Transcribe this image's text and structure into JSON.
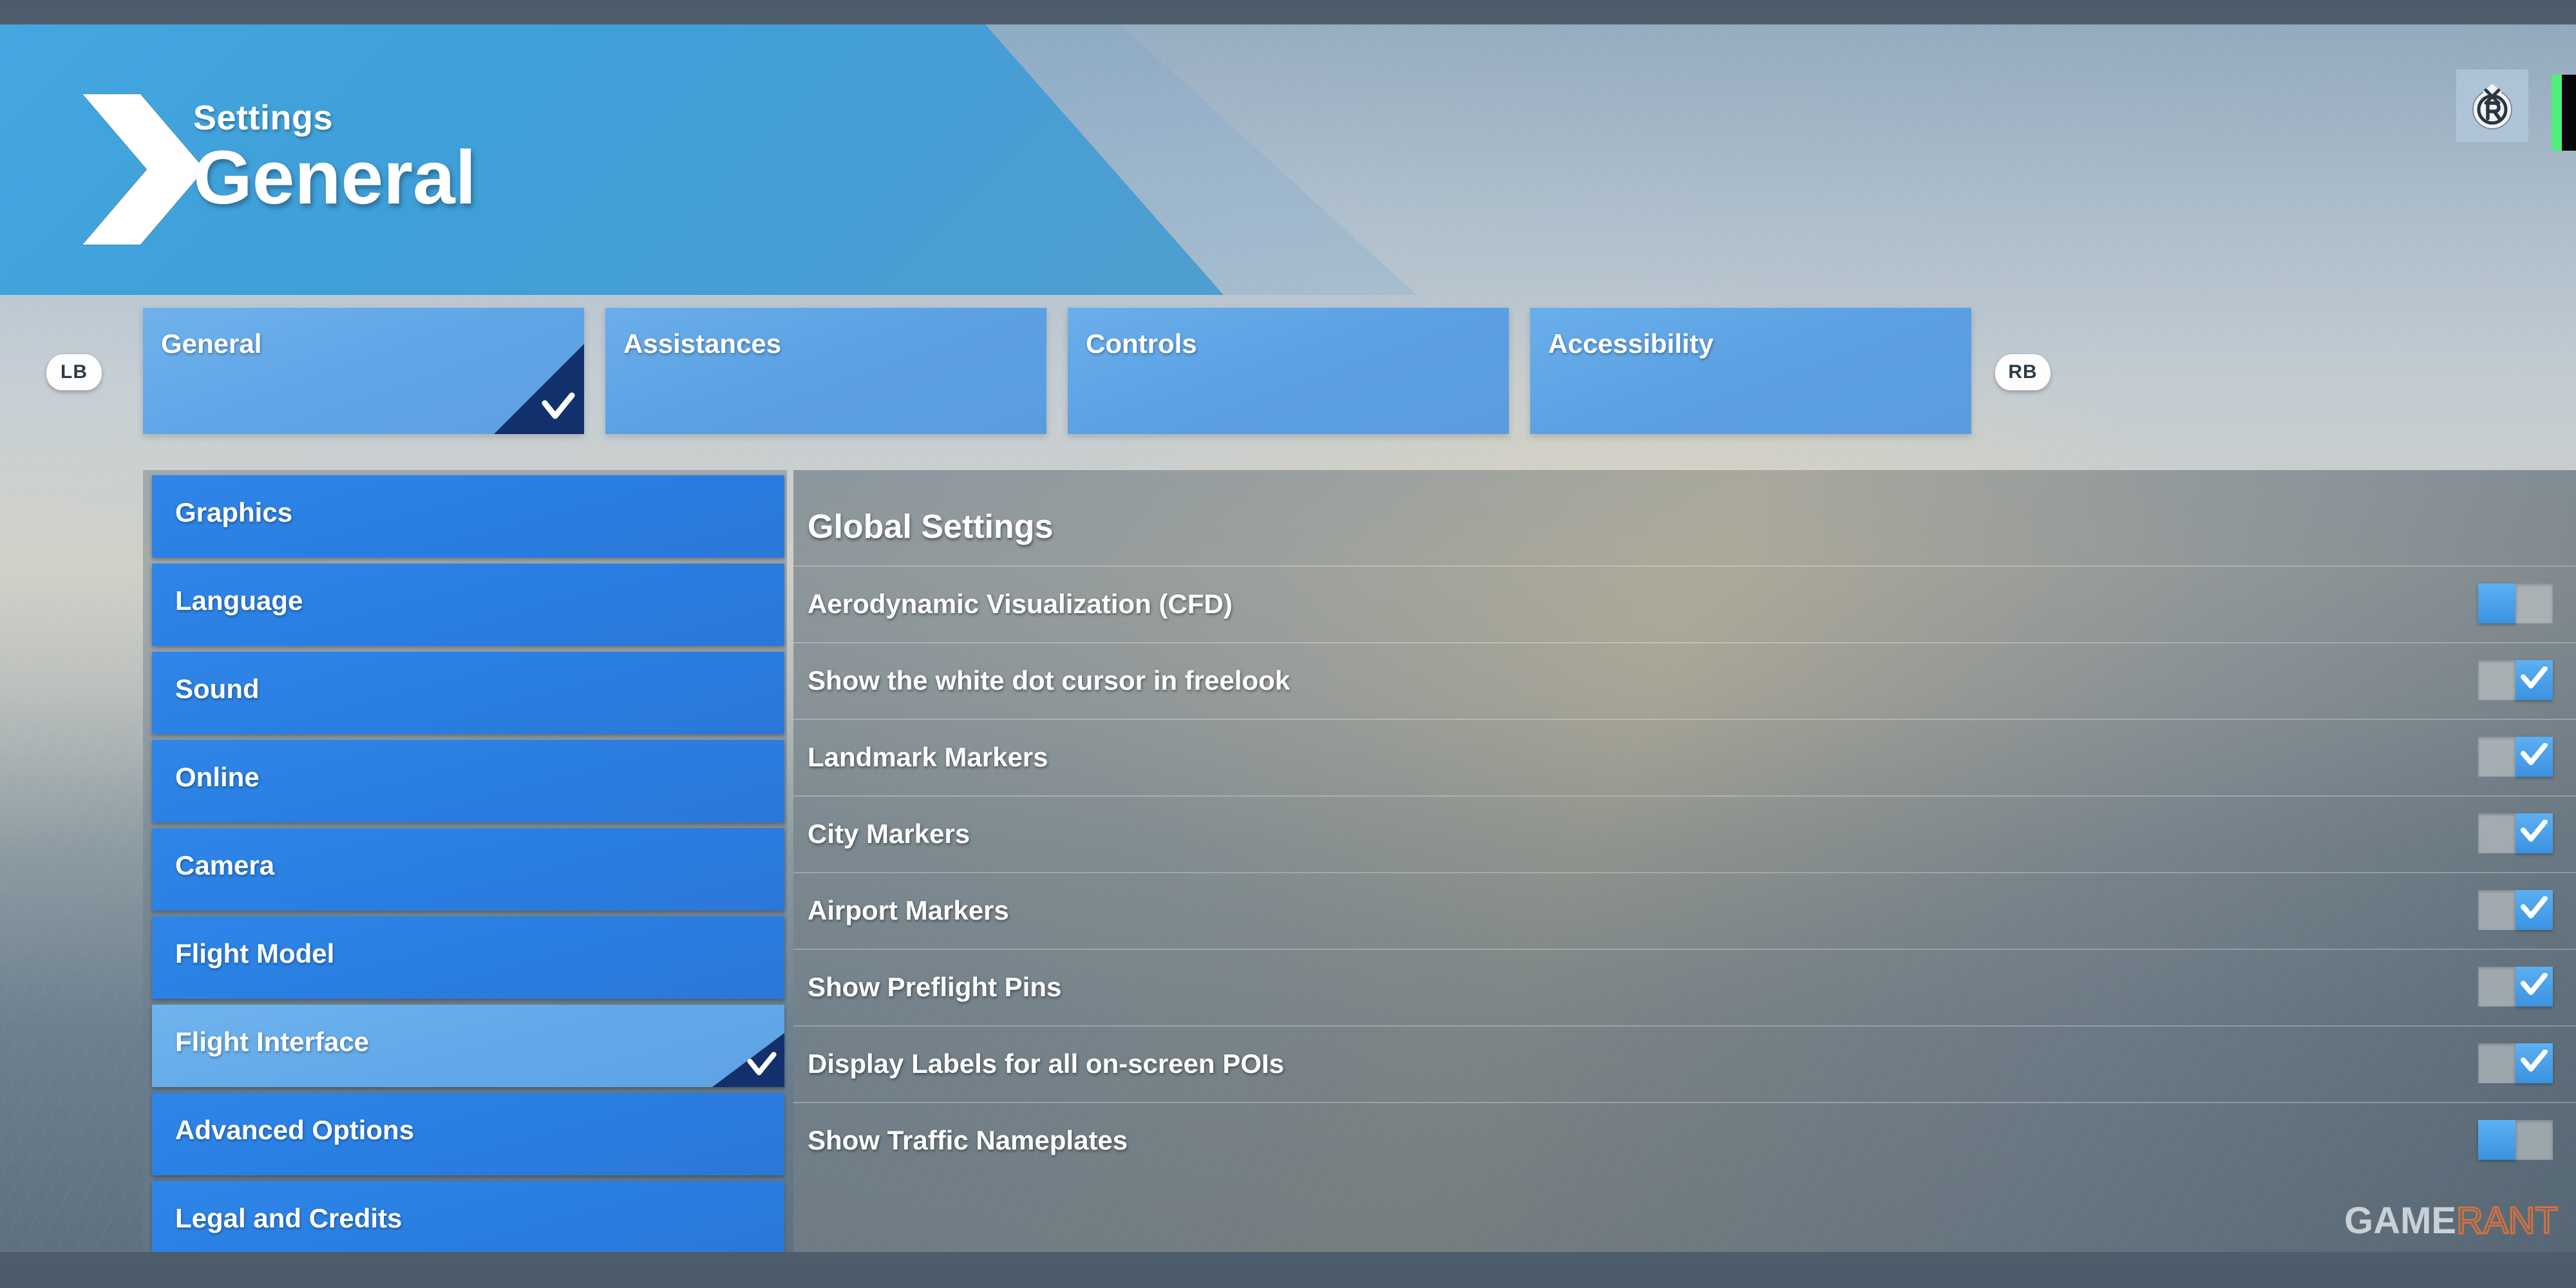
{
  "window": {
    "accent_blue": "#3f9fd8",
    "sidebar_blue": "#2a7fe2",
    "selected_blue": "#63a9e9",
    "corner_navy": "#12306b",
    "topbar_color": "#4b5b69"
  },
  "header": {
    "kicker": "Settings",
    "title": "General",
    "arrow_icon": "chevron-right-icon",
    "stick_icon": "right-stick-button-icon"
  },
  "tabs": {
    "prev_bumper": "LB",
    "next_bumper": "RB",
    "items": [
      {
        "label": "General",
        "active": true
      },
      {
        "label": "Assistances",
        "active": false
      },
      {
        "label": "Controls",
        "active": false
      },
      {
        "label": "Accessibility",
        "active": false
      }
    ]
  },
  "sidebar": {
    "items": [
      {
        "label": "Graphics",
        "selected": false
      },
      {
        "label": "Language",
        "selected": false
      },
      {
        "label": "Sound",
        "selected": false
      },
      {
        "label": "Online",
        "selected": false
      },
      {
        "label": "Camera",
        "selected": false
      },
      {
        "label": "Flight Model",
        "selected": false
      },
      {
        "label": "Flight Interface",
        "selected": true
      },
      {
        "label": "Advanced Options",
        "selected": false
      },
      {
        "label": "Legal and Credits",
        "selected": false
      }
    ]
  },
  "main": {
    "heading": "Global Settings",
    "rows": [
      {
        "label": "Aerodynamic Visualization (CFD)",
        "state": "off"
      },
      {
        "label": "Show the white dot cursor in freelook",
        "state": "on"
      },
      {
        "label": "Landmark Markers",
        "state": "on"
      },
      {
        "label": "City Markers",
        "state": "on"
      },
      {
        "label": "Airport Markers",
        "state": "on"
      },
      {
        "label": "Show Preflight Pins",
        "state": "on"
      },
      {
        "label": "Display Labels for all on-screen POIs",
        "state": "on"
      },
      {
        "label": "Show Traffic Nameplates",
        "state": "off"
      }
    ]
  },
  "watermark": {
    "part1": "GAME",
    "part2": "RANT"
  }
}
